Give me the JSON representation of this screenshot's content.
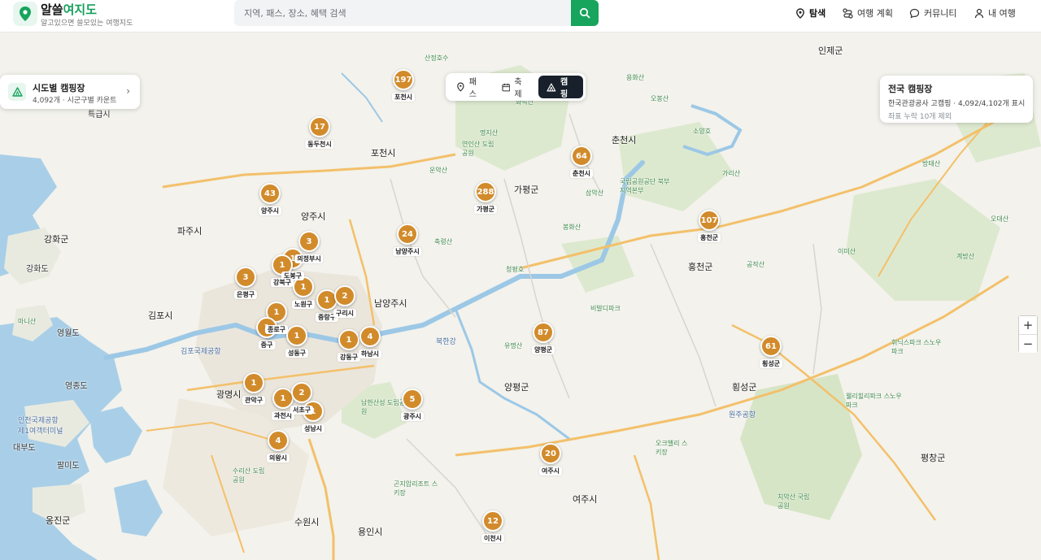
{
  "app": {
    "title_main": "알쓸",
    "title_accent": "여지도",
    "subtitle": "알고있으면 쓸모있는 여행지도"
  },
  "search": {
    "placeholder": "지역, 패스, 장소, 혜택 검색"
  },
  "nav": [
    {
      "label": "탐색",
      "icon": "map-pin-icon",
      "active": true
    },
    {
      "label": "여행 계획",
      "icon": "route-icon",
      "active": false
    },
    {
      "label": "커뮤니티",
      "icon": "chat-bubble-icon",
      "active": false
    },
    {
      "label": "내 여행",
      "icon": "user-icon",
      "active": false
    }
  ],
  "layer_tabs": [
    {
      "label": "패스",
      "icon": "pin-icon",
      "active": false
    },
    {
      "label": "축제",
      "icon": "calendar-icon",
      "active": false
    },
    {
      "label": "캠핑",
      "icon": "tent-icon",
      "active": true
    }
  ],
  "left_card": {
    "title": "시도별 캠핑장",
    "subtitle": "4,092개 · 시군구별 카운트"
  },
  "right_card": {
    "title": "전국 캠핑장",
    "subtitle": "한국관광공사 고캠핑 · 4,092/4,102개 표시",
    "note": "좌표 누락 10개 제외"
  },
  "zoom": {
    "in": "+",
    "out": "−"
  },
  "clusters": [
    {
      "count": "197",
      "label": "포천시"
    },
    {
      "count": "17",
      "label": "동두천시"
    },
    {
      "count": "43",
      "label": "양주시"
    },
    {
      "count": "3",
      "label": "의정부시"
    },
    {
      "count": "3",
      "label": "은평구"
    },
    {
      "count": "1",
      "label": "도봉구"
    },
    {
      "count": "1",
      "label": "강북구"
    },
    {
      "count": "1",
      "label": "노원구"
    },
    {
      "count": "1",
      "label": "중랑구"
    },
    {
      "count": "2",
      "label": "구리시"
    },
    {
      "count": "1",
      "label": "종로구"
    },
    {
      "count": "1",
      "label": "중구"
    },
    {
      "count": "1",
      "label": "성동구"
    },
    {
      "count": "1",
      "label": "강동구"
    },
    {
      "count": "4",
      "label": "하남시"
    },
    {
      "count": "1",
      "label": "관악구"
    },
    {
      "count": "1",
      "label": "과천시"
    },
    {
      "count": "2",
      "label": "서초구"
    },
    {
      "count": "1",
      "label": "성남시"
    },
    {
      "count": "4",
      "label": "의왕시"
    },
    {
      "count": "24",
      "label": "남양주시"
    },
    {
      "count": "288",
      "label": "가평군"
    },
    {
      "count": "64",
      "label": "춘천시"
    },
    {
      "count": "107",
      "label": "홍천군"
    },
    {
      "count": "87",
      "label": "양평군"
    },
    {
      "count": "61",
      "label": "횡성군"
    },
    {
      "count": "5",
      "label": "광주시"
    },
    {
      "count": "20",
      "label": "여주시"
    },
    {
      "count": "12",
      "label": "이천시"
    }
  ],
  "places": [
    {
      "name": "인제군"
    },
    {
      "name": "춘천시"
    },
    {
      "name": "포천시"
    },
    {
      "name": "가평군"
    },
    {
      "name": "양주시"
    },
    {
      "name": "파주시"
    },
    {
      "name": "강화군"
    },
    {
      "name": "김포시"
    },
    {
      "name": "남양주시"
    },
    {
      "name": "홍천군"
    },
    {
      "name": "양평군"
    },
    {
      "name": "횡성군"
    },
    {
      "name": "광명시"
    },
    {
      "name": "여주시"
    },
    {
      "name": "수원시"
    },
    {
      "name": "용인시"
    },
    {
      "name": "평창군"
    },
    {
      "name": "강화도"
    },
    {
      "name": "영종도"
    },
    {
      "name": "대부도"
    },
    {
      "name": "옹진군"
    },
    {
      "name": "팔미도"
    },
    {
      "name": "특급시"
    },
    {
      "name": "영월도"
    }
  ],
  "landmarks": [
    {
      "name": "명지산"
    },
    {
      "name": "운악산"
    },
    {
      "name": "화악산"
    },
    {
      "name": "용화산"
    },
    {
      "name": "오봉산"
    },
    {
      "name": "소양호"
    },
    {
      "name": "가리산"
    },
    {
      "name": "방태산"
    },
    {
      "name": "삼악산"
    },
    {
      "name": "봉화산"
    },
    {
      "name": "축령산"
    },
    {
      "name": "청평호"
    },
    {
      "name": "비발디파크"
    },
    {
      "name": "공작산"
    },
    {
      "name": "이미산"
    },
    {
      "name": "계방산"
    },
    {
      "name": "오대산"
    },
    {
      "name": "유명산"
    },
    {
      "name": "북한강"
    },
    {
      "name": "남한산성 도립공원"
    },
    {
      "name": "곤지암리조트 스키장"
    },
    {
      "name": "휘닉스파크 스노우파크"
    },
    {
      "name": "웰리힐리파크 스노우파크"
    },
    {
      "name": "치악산 국립공원"
    },
    {
      "name": "국립공원공단 북부지역본부"
    },
    {
      "name": "연인산 도립공원"
    },
    {
      "name": "수리산 도립공원"
    },
    {
      "name": "인천국제공항 제1여객터미널"
    },
    {
      "name": "김포국제공항"
    },
    {
      "name": "오크밸리 스키장"
    },
    {
      "name": "원주공항"
    },
    {
      "name": "마니산"
    },
    {
      "name": "산정호수"
    }
  ]
}
